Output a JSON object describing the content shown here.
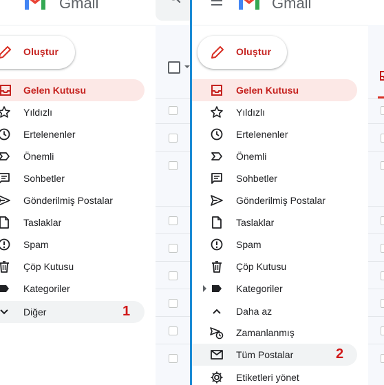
{
  "app": {
    "brand": "Gmail"
  },
  "compose": {
    "label": "Oluştur"
  },
  "left_nav": [
    {
      "label": "Gelen Kutusu"
    },
    {
      "label": "Yıldızlı"
    },
    {
      "label": "Ertelenenler"
    },
    {
      "label": "Önemli"
    },
    {
      "label": "Sohbetler"
    },
    {
      "label": "Gönderilmiş Postalar"
    },
    {
      "label": "Taslaklar"
    },
    {
      "label": "Spam"
    },
    {
      "label": "Çöp Kutusu"
    },
    {
      "label": "Kategoriler"
    },
    {
      "label": "Diğer"
    }
  ],
  "right_nav": [
    {
      "label": "Gelen Kutusu"
    },
    {
      "label": "Yıldızlı"
    },
    {
      "label": "Ertelenenler"
    },
    {
      "label": "Önemli"
    },
    {
      "label": "Sohbetler"
    },
    {
      "label": "Gönderilmiş Postalar"
    },
    {
      "label": "Taslaklar"
    },
    {
      "label": "Spam"
    },
    {
      "label": "Çöp Kutusu"
    },
    {
      "label": "Kategoriler"
    },
    {
      "label": "Daha az"
    },
    {
      "label": "Zamanlanmış"
    },
    {
      "label": "Tüm Postalar"
    },
    {
      "label": "Etiketleri yönet"
    }
  ],
  "annotations": {
    "step1": "1",
    "step2": "2"
  },
  "colors": {
    "accent": "#c5221f",
    "active_bg": "#fce8e6",
    "divider": "#1a8ad4",
    "annotation": "#d01818"
  }
}
